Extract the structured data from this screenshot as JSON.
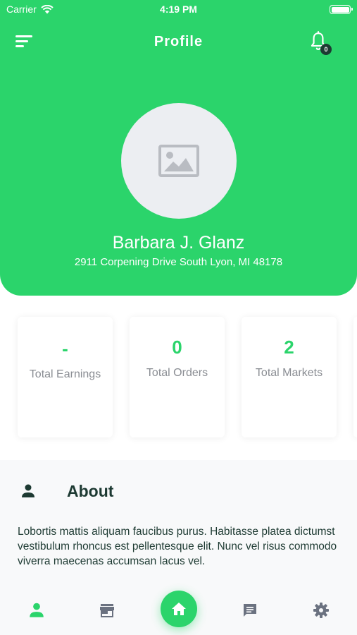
{
  "status_bar": {
    "carrier": "Carrier",
    "time": "4:19 PM",
    "wifi_icon": "wifi-icon",
    "battery_icon": "battery-icon"
  },
  "header": {
    "title": "Profile",
    "menu_icon": "menu-icon",
    "notification_icon": "bell-icon",
    "notification_count": "0",
    "background_color": "#2bd46b"
  },
  "profile": {
    "avatar_icon": "image-placeholder-icon",
    "name": "Barbara J. Glanz",
    "address": "2911 Corpening Drive South Lyon, MI 48178"
  },
  "stats": [
    {
      "value": "-",
      "label": "Total Earnings"
    },
    {
      "value": "0",
      "label": "Total Orders"
    },
    {
      "value": "2",
      "label": "Total Markets"
    }
  ],
  "about": {
    "icon": "person-icon",
    "title": "About",
    "text": "Lobortis mattis aliquam faucibus purus. Habitasse platea dictumst vestibulum rhoncus est pellentesque elit. Nunc vel risus commodo viverra maecenas accumsan lacus vel."
  },
  "bottom_nav": {
    "items": [
      "profile-icon",
      "store-icon",
      "home-icon",
      "chat-icon",
      "settings-icon"
    ],
    "active": "profile-icon",
    "accent_color": "#2bd46b",
    "inactive_color": "#6b7280"
  }
}
